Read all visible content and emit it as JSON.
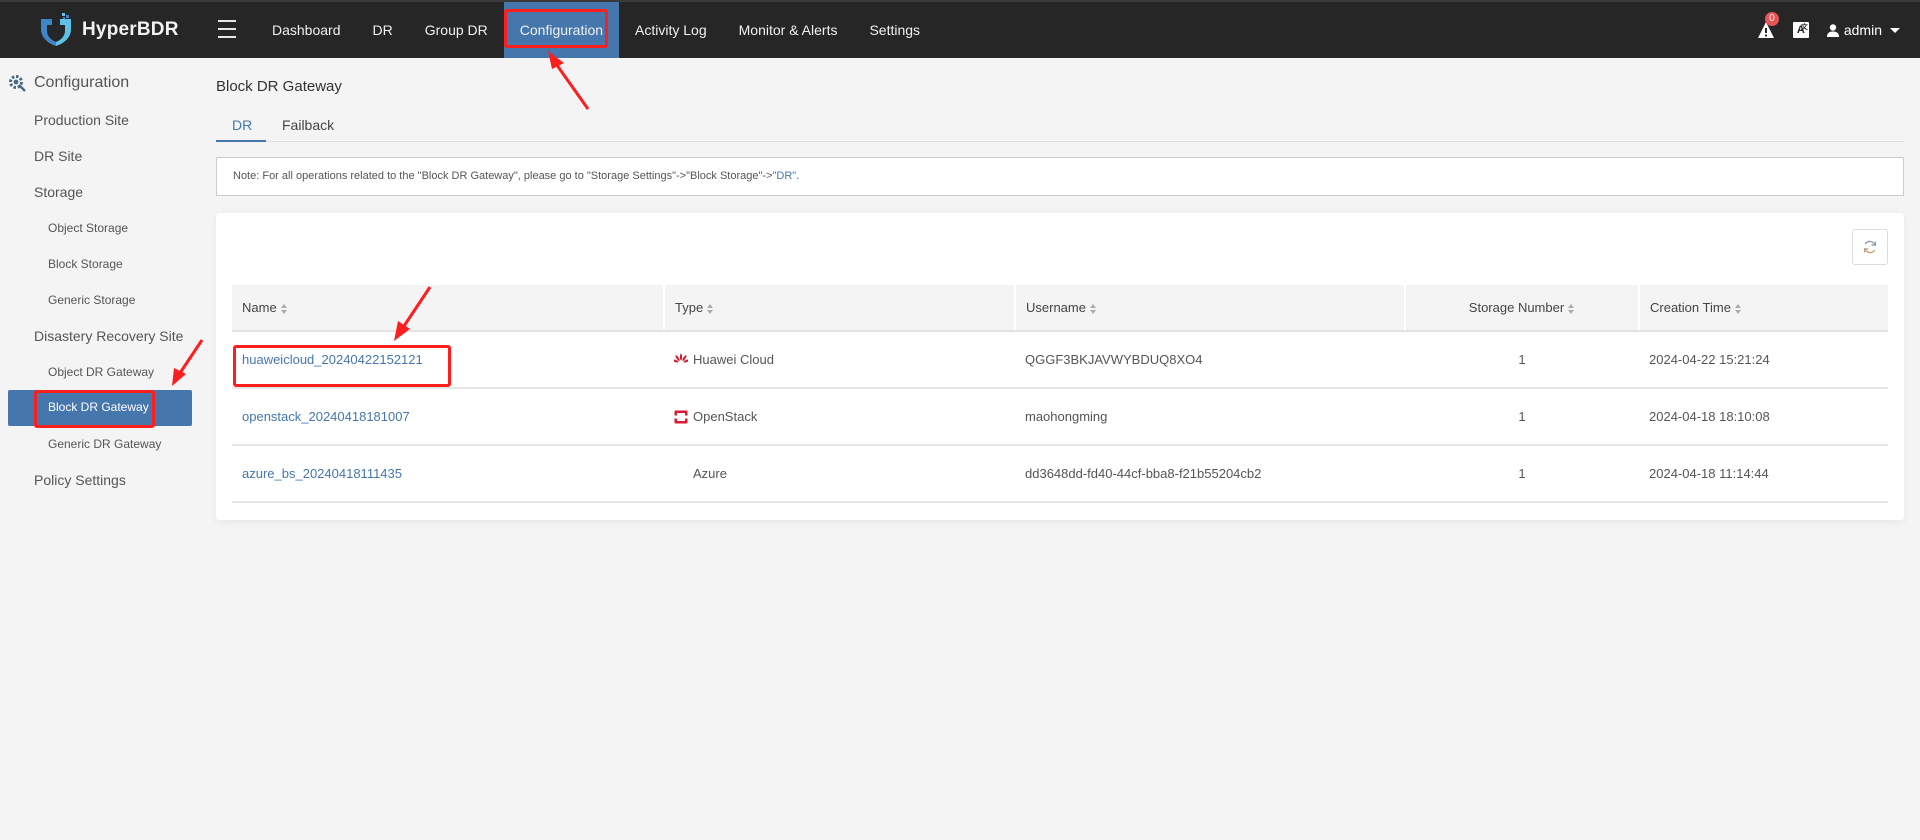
{
  "app": {
    "name": "HyperBDR",
    "logo_icon": "shield-logo-icon",
    "menu_icon": "hamburger-icon"
  },
  "nav": {
    "items": [
      {
        "label": "Dashboard",
        "active": false
      },
      {
        "label": "DR",
        "active": false
      },
      {
        "label": "Group DR",
        "active": false
      },
      {
        "label": "Configuration",
        "active": true
      },
      {
        "label": "Activity Log",
        "active": false
      },
      {
        "label": "Monitor & Alerts",
        "active": false
      },
      {
        "label": "Settings",
        "active": false
      }
    ],
    "alert_count": "0",
    "alert_icon": "warning-icon",
    "language_icon": "translate-icon",
    "language_glyph": "A",
    "user": "admin",
    "user_icon": "user-icon"
  },
  "sidebar": {
    "title": "Configuration",
    "title_icon": "gear-icon",
    "items": [
      {
        "label": "Production Site",
        "level": 1
      },
      {
        "label": "DR Site",
        "level": 1
      },
      {
        "label": "Storage",
        "level": 1
      },
      {
        "label": "Object Storage",
        "level": 2
      },
      {
        "label": "Block Storage",
        "level": 2
      },
      {
        "label": "Generic Storage",
        "level": 2
      },
      {
        "label": "Disastery Recovery Site",
        "level": 1
      },
      {
        "label": "Object DR Gateway",
        "level": 2
      },
      {
        "label": "Block DR Gateway",
        "level": 2,
        "active": true
      },
      {
        "label": "Generic DR Gateway",
        "level": 2
      },
      {
        "label": "Policy Settings",
        "level": 1
      }
    ]
  },
  "main": {
    "title": "Block DR Gateway",
    "tabs": [
      {
        "label": "DR",
        "active": true
      },
      {
        "label": "Failback",
        "active": false
      }
    ],
    "note": {
      "text": "Note: For all operations related to the \"Block DR Gateway\", please go to \"Storage Settings\"->\"Block Storage\"->",
      "link": "\"DR\"",
      "suffix": "."
    },
    "refresh_icon": "refresh-icon",
    "table": {
      "columns": [
        "Name",
        "Type",
        "Username",
        "Storage Number",
        "Creation Time"
      ],
      "rows": [
        {
          "name": "huaweicloud_20240422152121",
          "type": "Huawei Cloud",
          "type_icon": "huawei-icon",
          "username": "QGGF3BKJAVWYBDUQ8XO4",
          "storage_number": "1",
          "creation_time": "2024-04-22 15:21:24"
        },
        {
          "name": "openstack_20240418181007",
          "type": "OpenStack",
          "type_icon": "openstack-icon",
          "username": "maohongming",
          "storage_number": "1",
          "creation_time": "2024-04-18 18:10:08"
        },
        {
          "name": "azure_bs_20240418111435",
          "type": "Azure",
          "type_icon": "",
          "username": "dd3648dd-fd40-44cf-bba8-f21b55204cb2",
          "storage_number": "1",
          "creation_time": "2024-04-18 11:14:44"
        }
      ]
    }
  },
  "annotations": {
    "highlight_color": "#ff1e1e"
  },
  "colors": {
    "topbar_bg": "#262626",
    "accent": "#4577ad",
    "page_bg": "#f4f4f4",
    "badge": "#e85454"
  }
}
